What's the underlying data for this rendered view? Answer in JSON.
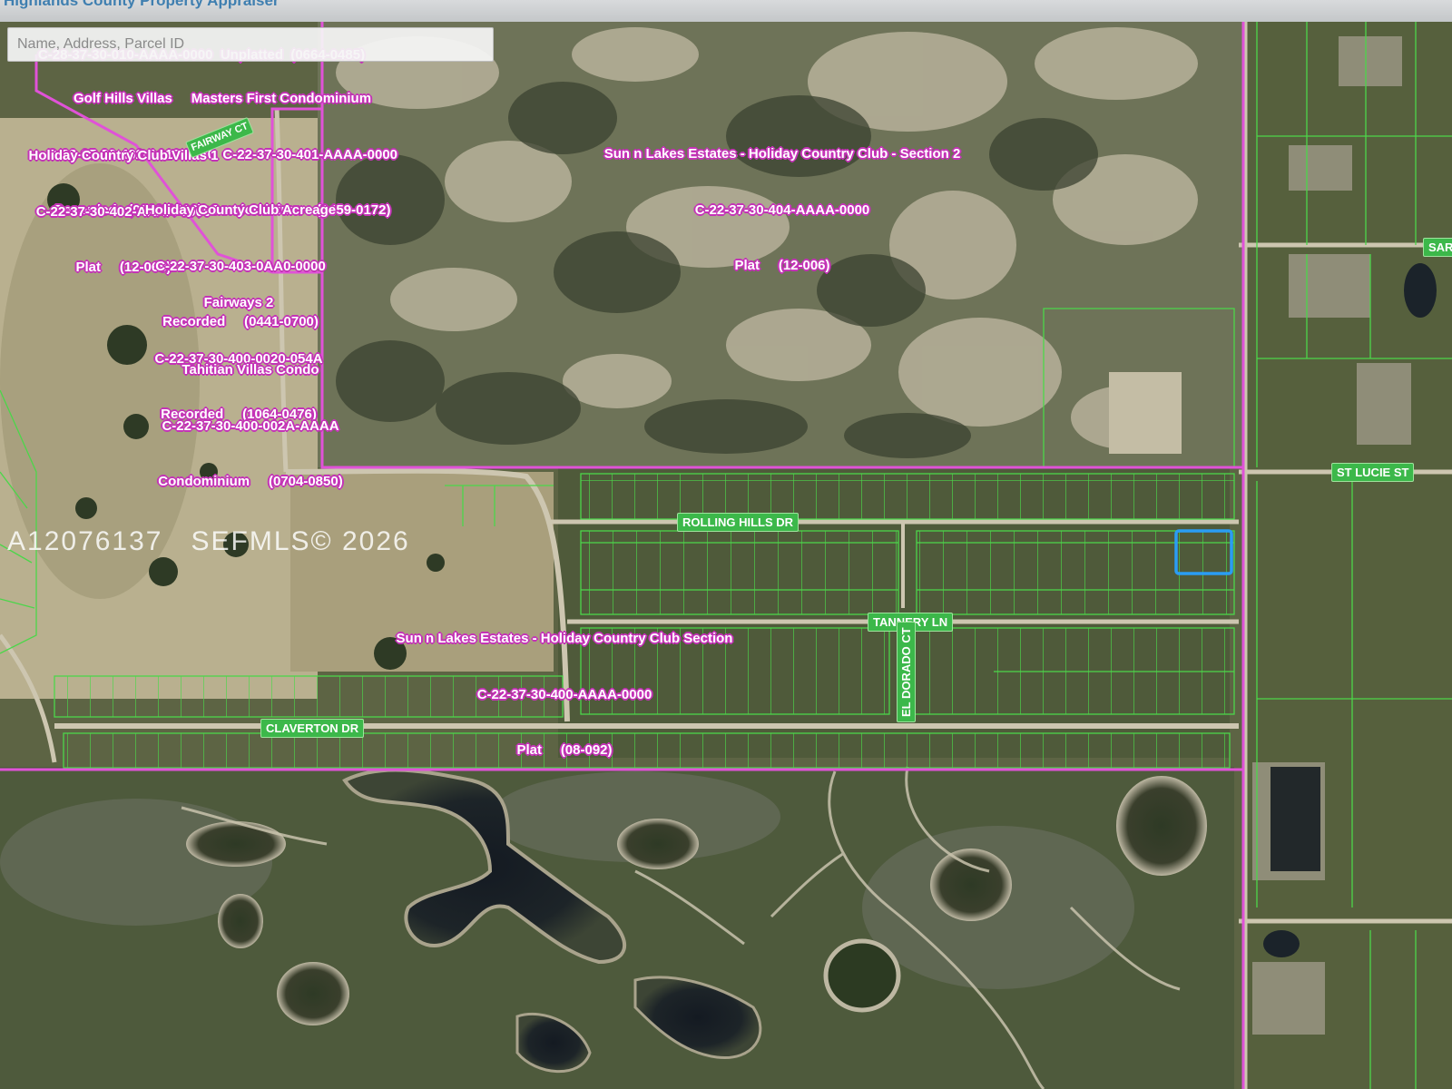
{
  "header": {
    "title": "Highlands County Property Appraiser"
  },
  "search": {
    "placeholder": "Name, Address, Parcel ID"
  },
  "watermark": {
    "listing_id": "A12076137",
    "copyright": "SEFMLS© 2026"
  },
  "top_cut_label": "C-28-37-30-010-AAAA-0000  Unplatted  (0664-0485)",
  "parcel_labels": [
    {
      "lines": [
        "Golf Hills Villas     Masters First Condominium",
        "C-22-37-30-402-A010-0000  C-22-37-30-401-AAAA-0000",
        "Recorded   (0992-0293)  Condominium    (0459-0172)"
      ]
    },
    {
      "lines": [
        "Holiday Country Club Villas 1",
        "C-22-37-30-402-AAAA-0000",
        "Plat     (12-068)"
      ]
    },
    {
      "lines": [
        "Holiday County Club Acreage",
        "C-22-37-30-403-0AA0-0000",
        "Recorded     (0441-0700)"
      ]
    },
    {
      "lines": [
        "Fairways 2",
        "C-22-37-30-400-0020-054A",
        "Recorded     (1064-0476)"
      ]
    },
    {
      "lines": [
        "Tahitian Villas Condo",
        "C-22-37-30-400-002A-AAAA",
        "Condominium     (0704-0850)"
      ]
    },
    {
      "lines": [
        "Sun n Lakes Estates - Holiday Country Club - Section 2",
        "C-22-37-30-404-AAAA-0000",
        "Plat     (12-006)"
      ]
    },
    {
      "lines": [
        "Sun n Lakes Estates - Holiday Country Club Section",
        "C-22-37-30-400-AAAA-0000",
        "Plat     (08-092)"
      ]
    }
  ],
  "streets": {
    "rolling_hills": "ROLLING HILLS DR",
    "tannery": "TANNERY LN",
    "el_dorado": "EL DORADO CT",
    "claverton": "CLAVERTON DR",
    "st_lucie": "ST LUCIE ST",
    "sar": "SAR",
    "fairway": "FAIRWAY CT"
  },
  "colors": {
    "parcel_boundary": "#e052d8",
    "lot_lines": "#4cd64a",
    "selected_parcel": "#2a9df4",
    "street_label_bg": "#3cb84a",
    "header_text": "#3f7fb0"
  }
}
